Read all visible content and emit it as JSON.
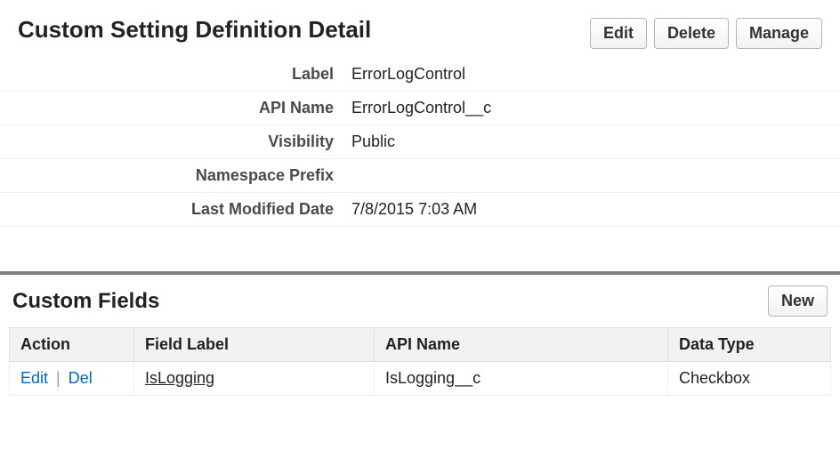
{
  "header": {
    "title": "Custom Setting Definition Detail",
    "buttons": {
      "edit": "Edit",
      "delete": "Delete",
      "manage": "Manage"
    }
  },
  "detail": {
    "rows": [
      {
        "label": "Label",
        "value": "ErrorLogControl"
      },
      {
        "label": "API Name",
        "value": "ErrorLogControl__c"
      },
      {
        "label": "Visibility",
        "value": "Public"
      },
      {
        "label": "Namespace Prefix",
        "value": ""
      },
      {
        "label": "Last Modified Date",
        "value": "7/8/2015 7:03 AM"
      }
    ]
  },
  "customFields": {
    "title": "Custom Fields",
    "newButton": "New",
    "columns": {
      "action": "Action",
      "fieldLabel": "Field Label",
      "apiName": "API Name",
      "dataType": "Data Type"
    },
    "actions": {
      "edit": "Edit",
      "del": "Del",
      "sep": "|"
    },
    "rows": [
      {
        "fieldLabel": "IsLogging",
        "apiName": "IsLogging__c",
        "dataType": "Checkbox"
      }
    ]
  }
}
